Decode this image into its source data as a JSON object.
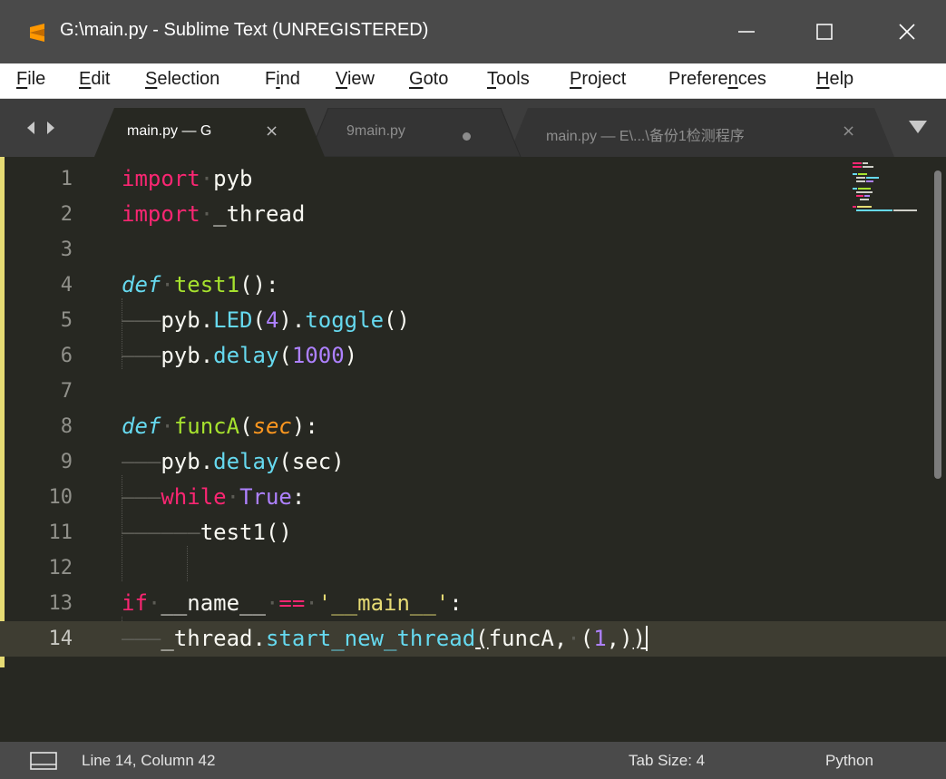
{
  "window": {
    "title": "G:\\main.py - Sublime Text (UNREGISTERED)",
    "app_icon": "sublime-text-icon",
    "buttons": [
      {
        "name": "minimize",
        "icon": "minimize-icon"
      },
      {
        "name": "maximize",
        "icon": "maximize-icon"
      },
      {
        "name": "close",
        "icon": "close-icon"
      }
    ]
  },
  "menu": {
    "items": [
      {
        "label": "File",
        "accel": "F",
        "rest": "ile"
      },
      {
        "label": "Edit",
        "accel": "E",
        "rest": "dit"
      },
      {
        "label": "Selection",
        "accel": "S",
        "rest": "election"
      },
      {
        "label": "Find",
        "accel": "i",
        "pre": "F",
        "rest": "nd"
      },
      {
        "label": "View",
        "accel": "V",
        "rest": "iew"
      },
      {
        "label": "Goto",
        "accel": "G",
        "rest": "oto"
      },
      {
        "label": "Tools",
        "accel": "T",
        "rest": "ools"
      },
      {
        "label": "Project",
        "accel": "P",
        "rest": "roject"
      },
      {
        "label": "Preferences",
        "pre": "Prefere",
        "accel": "n",
        "rest": "ces"
      },
      {
        "label": "Help",
        "accel": "H",
        "rest": "elp"
      }
    ]
  },
  "tabs": [
    {
      "label": "main.py — G",
      "active": true,
      "state": "close"
    },
    {
      "label": "9main.py",
      "active": false,
      "state": "modified"
    },
    {
      "label": "main.py — E\\...\\备份1检测程序",
      "active": false,
      "state": "close"
    }
  ],
  "editor": {
    "current_line": 14,
    "line_numbers": [
      "1",
      "2",
      "3",
      "4",
      "5",
      "6",
      "7",
      "8",
      "9",
      "10",
      "11",
      "12",
      "13",
      "14"
    ],
    "language": "python",
    "cursor": {
      "line": 14,
      "column": 42
    }
  },
  "status": {
    "position": "Line 14, Column 42",
    "tab_size": "Tab Size: 4",
    "syntax": "Python",
    "panel_icon": "panel-toggle-icon"
  },
  "colors": {
    "background": "#272822",
    "keyword": "#f92672",
    "function": "#a6e22e",
    "builtin": "#66d9ef",
    "number": "#ae81ff",
    "string": "#e6db74",
    "parameter": "#fd971f",
    "chrome": "#4a4a4a"
  }
}
